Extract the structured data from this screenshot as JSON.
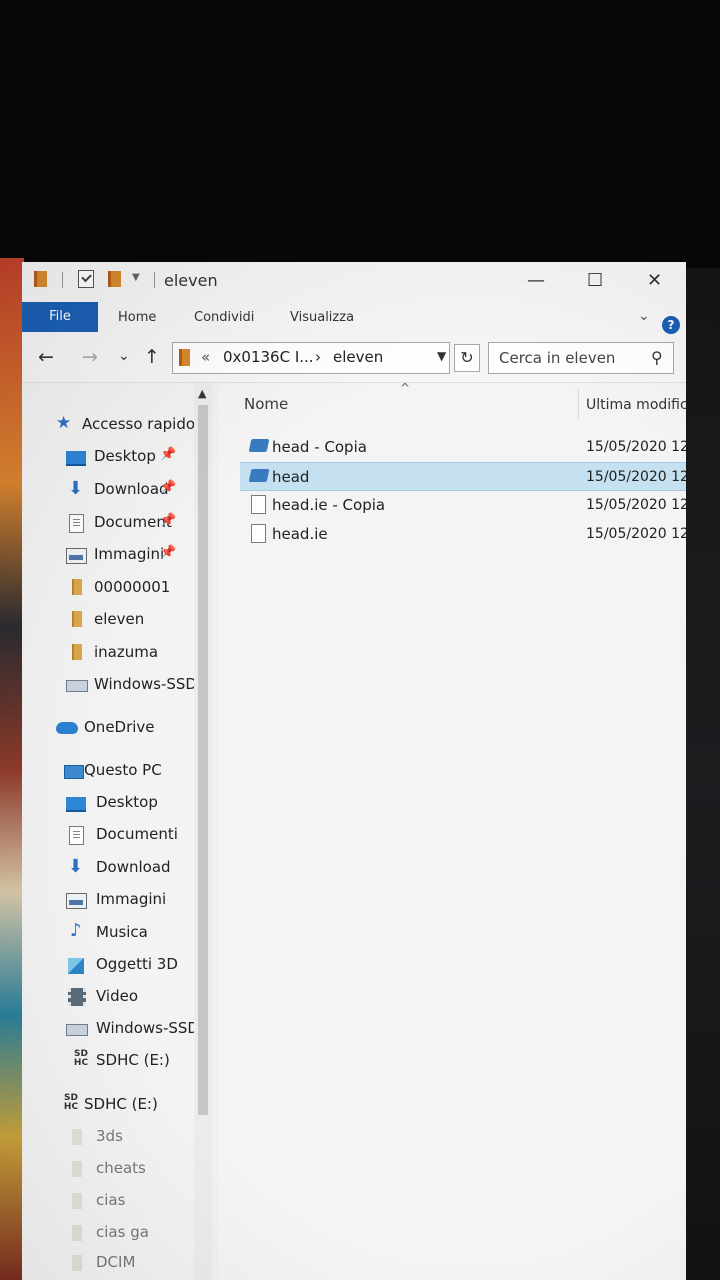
{
  "title_bar": {
    "title": "eleven",
    "minimize": "—",
    "maximize": "☐",
    "close": "✕"
  },
  "ribbon": {
    "tabs": [
      "File",
      "Home",
      "Condividi",
      "Visualizza"
    ],
    "collapse_icon": "chevron-down-icon",
    "help_icon": "?"
  },
  "address_bar": {
    "back": "←",
    "forward": "→",
    "recent": "⌄",
    "up": "↑",
    "overflow": "«",
    "segments": [
      "0x0136C I...",
      "eleven"
    ],
    "separator": "›",
    "dropdown": "▼",
    "refresh": "↻"
  },
  "search": {
    "placeholder": "Cerca in eleven",
    "icon": "search-icon"
  },
  "nav_pane": {
    "quick_access": {
      "label": "Accesso rapido",
      "items": [
        {
          "label": "Desktop",
          "icon": "desktop-icon",
          "pinned": true
        },
        {
          "label": "Download",
          "icon": "download-icon",
          "pinned": true
        },
        {
          "label": "Document",
          "icon": "documents-icon",
          "pinned": true
        },
        {
          "label": "Immagini",
          "icon": "pictures-icon",
          "pinned": true
        },
        {
          "label": "00000001",
          "icon": "folder-icon",
          "pinned": false
        },
        {
          "label": "eleven",
          "icon": "folder-icon",
          "pinned": false
        },
        {
          "label": "inazuma",
          "icon": "folder-icon",
          "pinned": false
        },
        {
          "label": "Windows-SSD",
          "icon": "drive-icon",
          "pinned": false
        }
      ],
      "pin_glyph": "📌"
    },
    "onedrive": {
      "label": "OneDrive",
      "icon": "cloud-icon"
    },
    "this_pc": {
      "label": "Questo PC",
      "items": [
        {
          "label": "Desktop",
          "icon": "desktop-icon"
        },
        {
          "label": "Documenti",
          "icon": "documents-icon"
        },
        {
          "label": "Download",
          "icon": "download-icon"
        },
        {
          "label": "Immagini",
          "icon": "pictures-icon"
        },
        {
          "label": "Musica",
          "icon": "music-icon"
        },
        {
          "label": "Oggetti 3D",
          "icon": "3d-objects-icon"
        },
        {
          "label": "Video",
          "icon": "video-icon"
        },
        {
          "label": "Windows-SSD",
          "icon": "drive-icon"
        },
        {
          "label": "SDHC (E:)",
          "icon": "sd-card-icon"
        }
      ]
    },
    "sd_card": {
      "label": "SDHC (E:)",
      "icon": "sd-card-icon",
      "sd_glyph_top": "SD",
      "sd_glyph_bottom": "HC",
      "folders": [
        "3ds",
        "cheats",
        "cias",
        "cias ga",
        "DCIM"
      ]
    }
  },
  "file_list": {
    "columns": {
      "name": "Nome",
      "date": "Ultima modifica"
    },
    "sorted_by": "Nome",
    "rows": [
      {
        "name": "head - Copia",
        "date": "15/05/2020 12",
        "icon": "generic-file-icon",
        "selected": false
      },
      {
        "name": "head",
        "date": "15/05/2020 12",
        "icon": "generic-file-icon",
        "selected": true
      },
      {
        "name": "head.ie - Copia",
        "date": "15/05/2020 12",
        "icon": "blank-file-icon",
        "selected": false
      },
      {
        "name": "head.ie",
        "date": "15/05/2020 12",
        "icon": "blank-file-icon",
        "selected": false
      }
    ]
  },
  "colors": {
    "file_tab": "#1a5fb4",
    "selection": "#c5e0f0",
    "folder": "#d9a84c"
  }
}
